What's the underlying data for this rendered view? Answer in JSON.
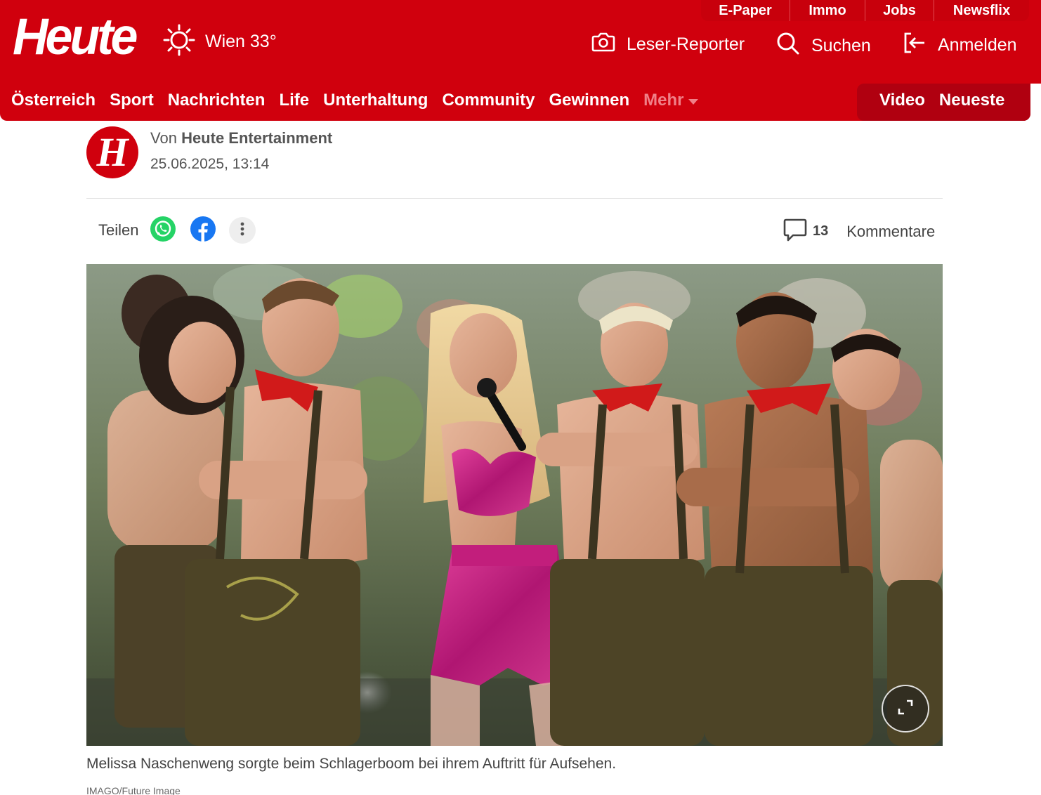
{
  "header": {
    "logo": "Heute",
    "weather": {
      "icon": "sun-icon",
      "text": "Wien 33°"
    },
    "topbar": [
      {
        "label": "E-Paper"
      },
      {
        "label": "Immo"
      },
      {
        "label": "Jobs"
      },
      {
        "label": "Newsflix"
      }
    ],
    "actions": {
      "reporter": {
        "icon": "camera-icon",
        "label": "Leser-Reporter"
      },
      "search": {
        "icon": "search-icon",
        "label": "Suchen"
      },
      "login": {
        "icon": "login-icon",
        "label": "Anmelden"
      }
    },
    "nav": [
      {
        "label": "Österreich"
      },
      {
        "label": "Sport"
      },
      {
        "label": "Nachrichten"
      },
      {
        "label": "Life"
      },
      {
        "label": "Unterhaltung"
      },
      {
        "label": "Community"
      },
      {
        "label": "Gewinnen"
      }
    ],
    "nav_more": "Mehr",
    "nav_right": [
      {
        "label": "Video"
      },
      {
        "label": "Neueste"
      }
    ],
    "brand_color": "#d0000d"
  },
  "article": {
    "author_prefix": "Von",
    "author_name": "Heute Entertainment",
    "avatar_letter": "H",
    "date": "25.06.2025, 13:14",
    "share_label": "Teilen",
    "comment_count": "13",
    "comment_label": "Kommentare",
    "caption": "Melissa Naschenweng sorgte beim Schlagerboom bei ihrem Auftritt für Aufsehen.",
    "credit": "IMAGO/Future Image"
  }
}
